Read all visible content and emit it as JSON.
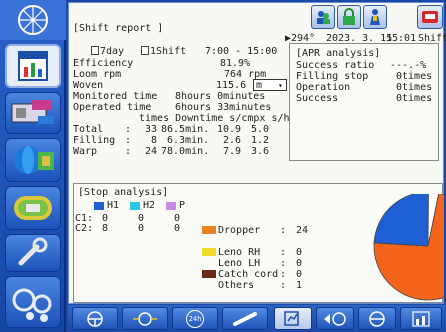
{
  "header": {
    "title": "[Shift report ]",
    "angle": "▶294°",
    "date": "2023. 3. 15",
    "time": "15:01",
    "mode": "Shift"
  },
  "period": {
    "day_label": "7day",
    "shift_label": "1Shift",
    "range": "7:00 - 15:00"
  },
  "metrics": [
    {
      "label": "Efficiency",
      "value": "81.9%"
    },
    {
      "label": "Loom rpm",
      "value": "764 rpm"
    },
    {
      "label": "Woven",
      "value": "115.6"
    },
    {
      "label": "Monitored time",
      "value": "8hours  0minutes"
    },
    {
      "label": "Operated time",
      "value": "6hours 33minutes"
    }
  ],
  "woven_unit": "m",
  "stop_table": {
    "headers": "times Downtime s/cmpx  s/h",
    "rows": [
      {
        "label": "Total",
        "sep": ":",
        "times": "33",
        "downtime": "86.5min.",
        "scmpx": "10.9",
        "sh": "5.0"
      },
      {
        "label": "Filling",
        "sep": ":",
        "times": "8",
        "downtime": "6.3min.",
        "scmpx": "2.6",
        "sh": "1.2"
      },
      {
        "label": "Warp",
        "sep": ":",
        "times": "24",
        "downtime": "78.0min.",
        "scmpx": "7.9",
        "sh": "3.6"
      }
    ]
  },
  "apr": {
    "title": "[APR analysis]",
    "rows": [
      {
        "label": "Success ratio",
        "value": "---.-%"
      },
      {
        "label": "Filling stop",
        "value": "0times"
      },
      {
        "label": "Operation",
        "value": "0times"
      },
      {
        "label": "Success",
        "value": "0times"
      }
    ]
  },
  "stop_analysis": {
    "title": "[Stop analysis]",
    "legend": [
      {
        "label": "H1",
        "color": "#1f5fd6"
      },
      {
        "label": "H2",
        "color": "#2ec8e8"
      },
      {
        "label": "P",
        "color": "#c98ae8"
      }
    ],
    "rows": [
      {
        "label": "C1:",
        "h1": "0",
        "h2": "0",
        "p": "0"
      },
      {
        "label": "C2:",
        "h1": "8",
        "h2": "0",
        "p": "0"
      }
    ],
    "causes": [
      {
        "label": "Dropper",
        "value": "24",
        "color": "#e8821e"
      },
      {
        "label": "Leno RH",
        "value": "0",
        "color": "#f0dc28"
      },
      {
        "label": "Leno LH",
        "value": "0",
        "color": "#f0dc28"
      },
      {
        "label": "Catch cord",
        "value": "0",
        "color": "#6a2a18"
      },
      {
        "label": "Others",
        "value": "1",
        "color": "#ffffff"
      }
    ],
    "pie": [
      {
        "label": "Dropper",
        "value": 24,
        "color": "#f4641c"
      },
      {
        "label": "Filling",
        "value": 8,
        "color": "#1f5fd6"
      },
      {
        "label": "Others",
        "value": 1,
        "color": "#ffffff"
      }
    ]
  },
  "bottom_bar": {
    "btn_24h": "24h"
  }
}
